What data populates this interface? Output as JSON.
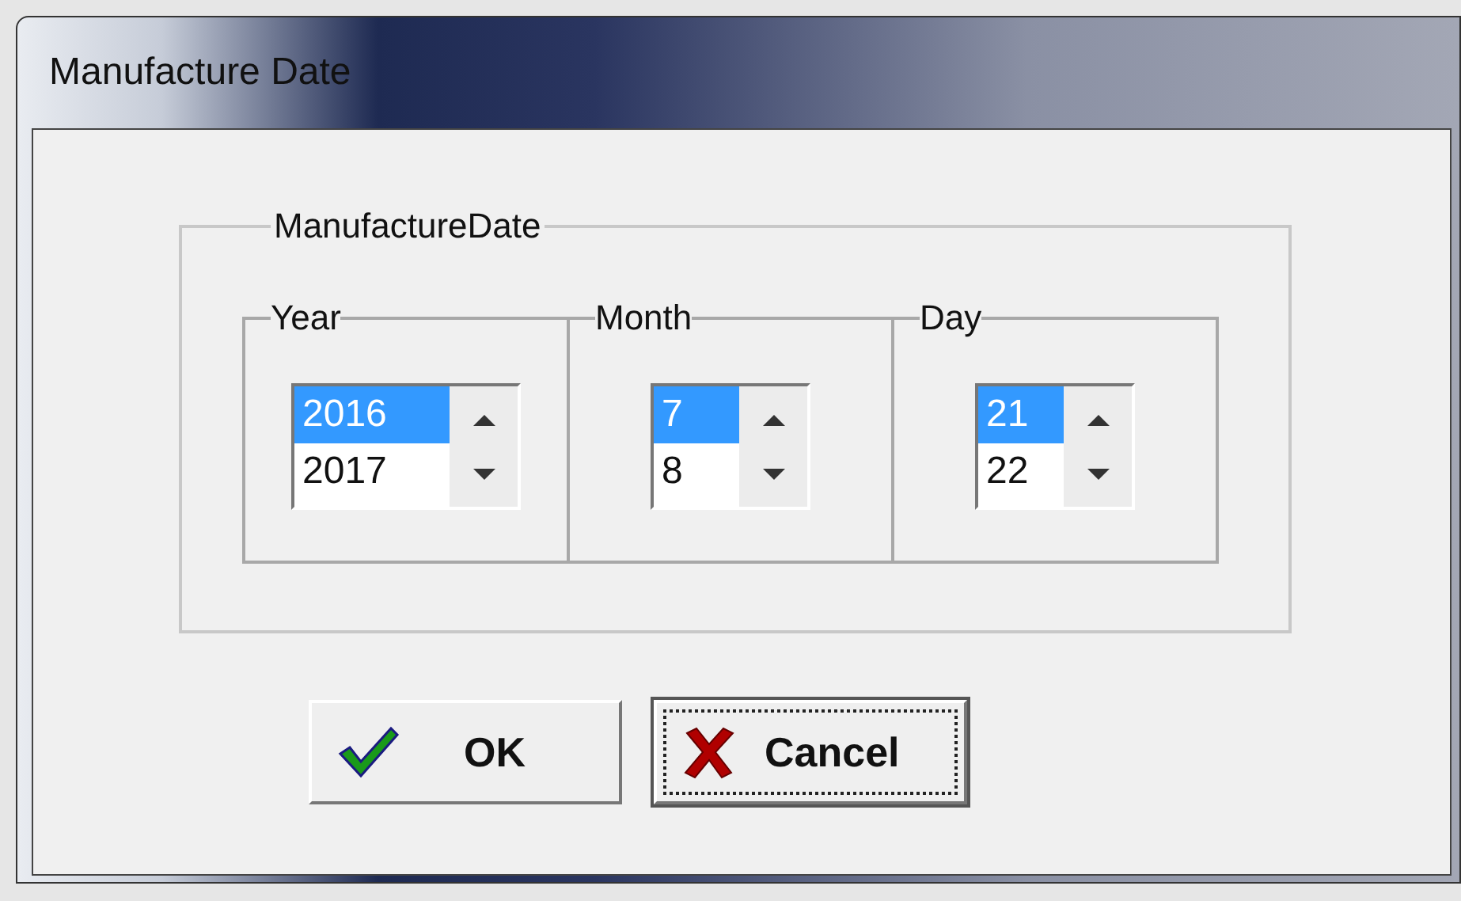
{
  "window": {
    "title": "Manufacture Date"
  },
  "group": {
    "label": "ManufactureDate",
    "fields": [
      {
        "label": "Year",
        "items": [
          {
            "text": "2016",
            "selected": true
          },
          {
            "text": "2017",
            "selected": false
          }
        ]
      },
      {
        "label": "Month",
        "items": [
          {
            "text": "7",
            "selected": true
          },
          {
            "text": "8",
            "selected": false
          }
        ]
      },
      {
        "label": "Day",
        "items": [
          {
            "text": "21",
            "selected": true
          },
          {
            "text": "22",
            "selected": false
          }
        ]
      }
    ]
  },
  "buttons": [
    {
      "label": "OK",
      "kind": "ok",
      "focused": false
    },
    {
      "label": "Cancel",
      "kind": "cancel",
      "focused": true
    }
  ]
}
